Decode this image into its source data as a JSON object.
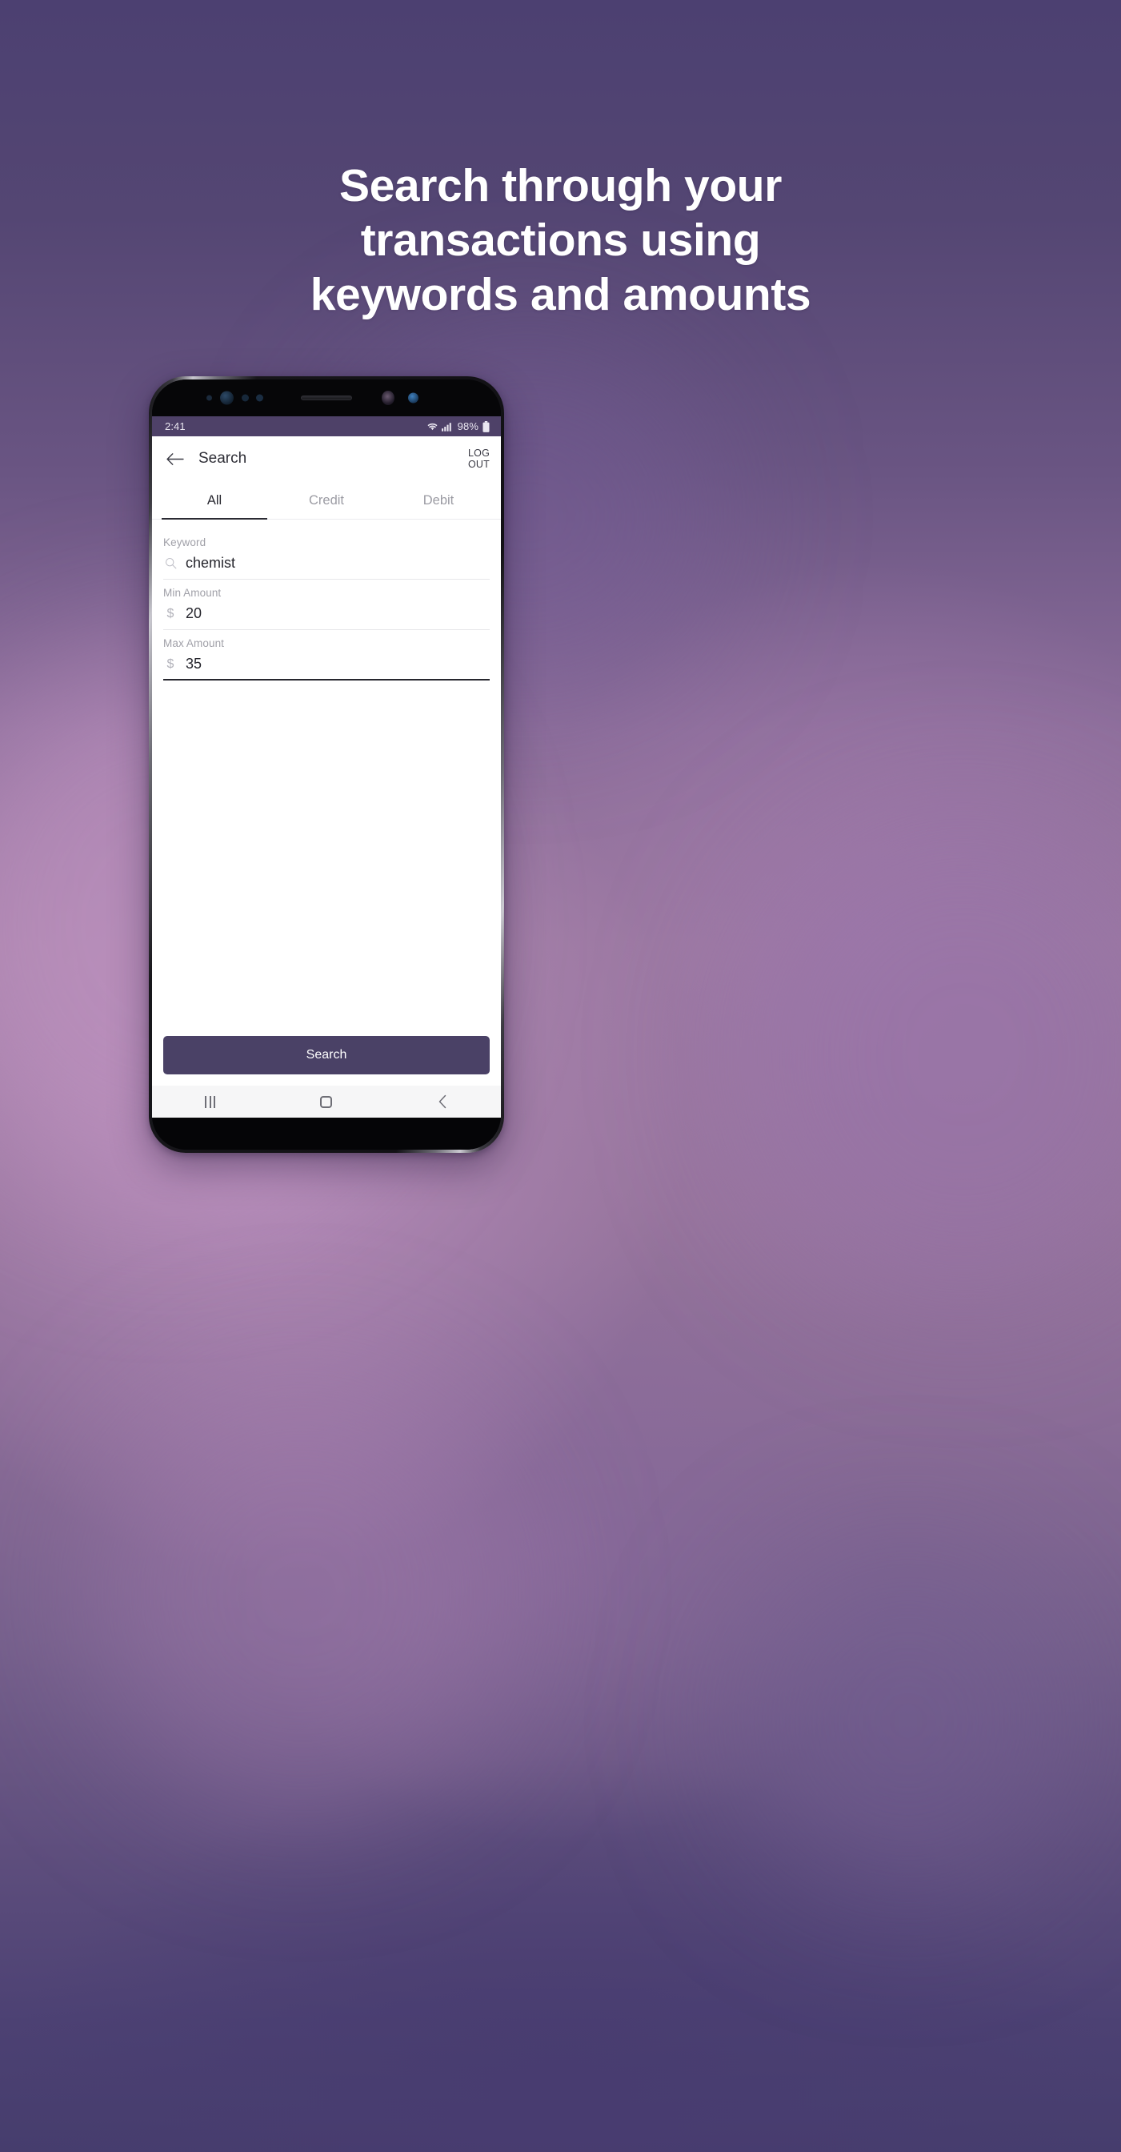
{
  "promo": {
    "headline_lines": [
      "Search through your",
      "transactions using",
      "keywords and amounts"
    ],
    "headline_color": "#ffffff",
    "background_colors": [
      "#4c4071",
      "#9a789f",
      "#463d6d"
    ]
  },
  "device": {
    "status_bar": {
      "time": "2:41",
      "battery_percent": "98%",
      "wifi_icon": "wifi-icon",
      "signal_icon": "signal-bars-icon",
      "battery_icon": "battery-icon",
      "background_color": "#4e4168"
    },
    "nav_bar": {
      "recents_label": "recents-icon",
      "home_label": "home-icon",
      "back_label": "back-icon"
    }
  },
  "app": {
    "appbar": {
      "back_icon": "arrow-left-icon",
      "title": "Search",
      "logout_line1": "LOG",
      "logout_line2": "OUT"
    },
    "tabs": [
      {
        "label": "All",
        "active": true
      },
      {
        "label": "Credit",
        "active": false
      },
      {
        "label": "Debit",
        "active": false
      }
    ],
    "fields": [
      {
        "label": "Keyword",
        "prefix": "search-icon",
        "prefix_text": "",
        "value": "chemist",
        "focused": false
      },
      {
        "label": "Min Amount",
        "prefix": "dollar-sign",
        "prefix_text": "$",
        "value": "20",
        "focused": false
      },
      {
        "label": "Max Amount",
        "prefix": "dollar-sign",
        "prefix_text": "$",
        "value": "35",
        "focused": true
      }
    ],
    "primary_button": {
      "label": "Search",
      "color": "#4a4166",
      "text_color": "#ffffff"
    }
  }
}
